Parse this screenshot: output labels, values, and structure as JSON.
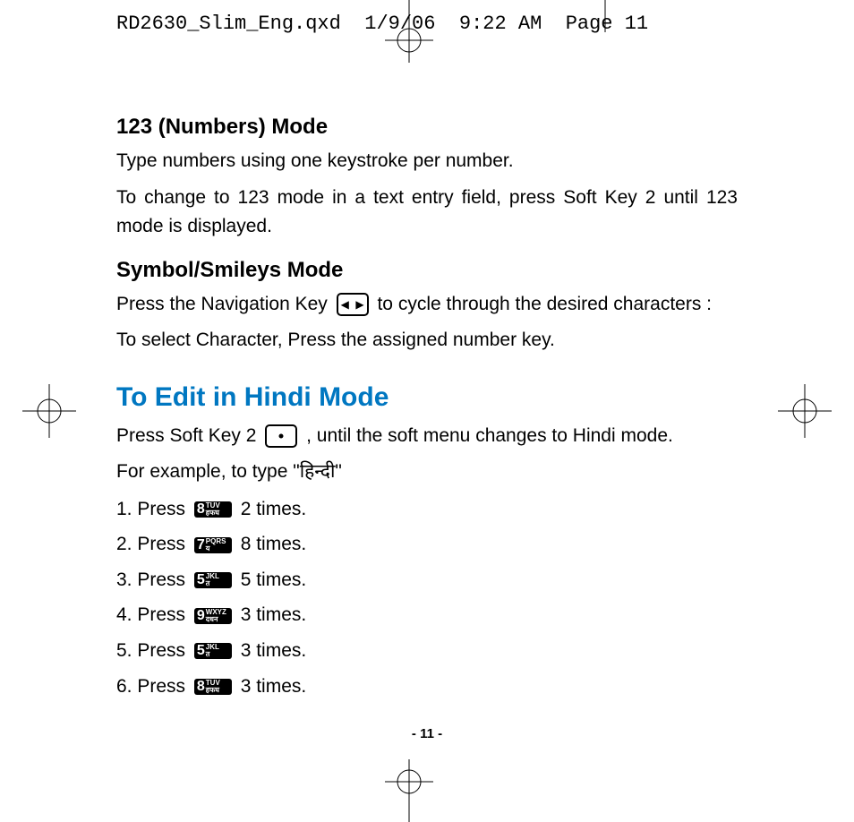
{
  "header": {
    "filename": "RD2630_Slim_Eng.qxd",
    "date": "1/9/06",
    "time": "9:22 AM",
    "page_label": "Page 11"
  },
  "section1": {
    "title": "123 (Numbers) Mode",
    "p1": "Type numbers using one keystroke per number.",
    "p2": "To change to 123 mode in a text entry field, press Soft Key 2 until 123 mode is displayed."
  },
  "section2": {
    "title": "Symbol/Smileys Mode",
    "p1a": "Press the Navigation Key ",
    "p1b": " to cycle through the desired characters :",
    "p2": "To select Character, Press the assigned number key."
  },
  "section3": {
    "title": "To Edit in Hindi Mode",
    "p1a": "Press Soft Key 2  ",
    "p1b": " , until the soft menu changes to Hindi mode.",
    "p2a": "For example, to type \"",
    "hindi_word": "हिन्दी",
    "p2b": "\""
  },
  "steps": [
    {
      "n": "1.",
      "pre": "Press",
      "key_big": "8",
      "key_sm_top": "TUV",
      "key_sm_bot": "हफघ",
      "post": "2 times."
    },
    {
      "n": "2.",
      "pre": "Press",
      "key_big": "7",
      "key_sm_top": "PQRS",
      "key_sm_bot": "य",
      "post": " 8 times."
    },
    {
      "n": "3.",
      "pre": "Press",
      "key_big": "5",
      "key_sm_top": "JKL",
      "key_sm_bot": "त",
      "post": "5 times."
    },
    {
      "n": "4.",
      "pre": "Press",
      "key_big": "9",
      "key_sm_top": "WXYZ",
      "key_sm_bot": "दधन",
      "post": "3 times."
    },
    {
      "n": "5.",
      "pre": "Press",
      "key_big": "5",
      "key_sm_top": "JKL",
      "key_sm_bot": "त",
      "post": "3 times."
    },
    {
      "n": "6.",
      "pre": "Press",
      "key_big": "8",
      "key_sm_top": "TUV",
      "key_sm_bot": "हफघ",
      "post": "3 times."
    }
  ],
  "page_number": "- 11 -"
}
